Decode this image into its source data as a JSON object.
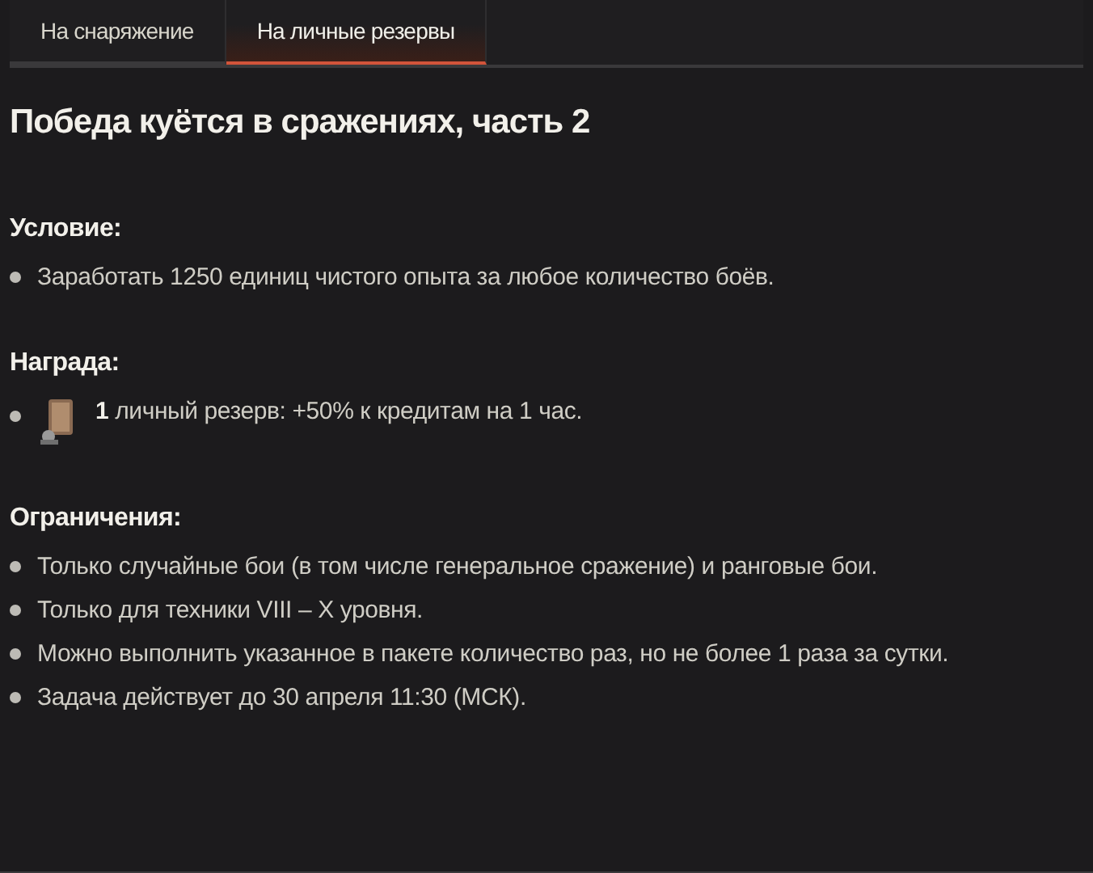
{
  "tabs": [
    {
      "label": "На снаряжение",
      "selected": false
    },
    {
      "label": "На личные резервы",
      "selected": true
    }
  ],
  "title": "Победа куётся в сражениях, часть 2",
  "sections": [
    {
      "heading": "Условие:",
      "items": [
        {
          "kind": "text",
          "text": "Заработать 1250 единиц чистого опыта за любое количество боёв."
        }
      ]
    },
    {
      "heading": "Награда:",
      "items": [
        {
          "kind": "reward",
          "text": "**1** личный резерв: +50% к кредитам на 1 час."
        }
      ]
    },
    {
      "heading": "Ограничения:",
      "items": [
        {
          "kind": "text",
          "text": "Только случайные бои (в том числе генеральное сражение) и ранговые бои."
        },
        {
          "kind": "text",
          "text": "Только для техники VIII – X уровня."
        },
        {
          "kind": "text",
          "text": "Можно выполнить указанное в пакете количество раз, но не более 1 раза за сутки."
        },
        {
          "kind": "text",
          "text": "Задача действует до 30 апреля 11:30 (МСК)."
        }
      ]
    }
  ]
}
